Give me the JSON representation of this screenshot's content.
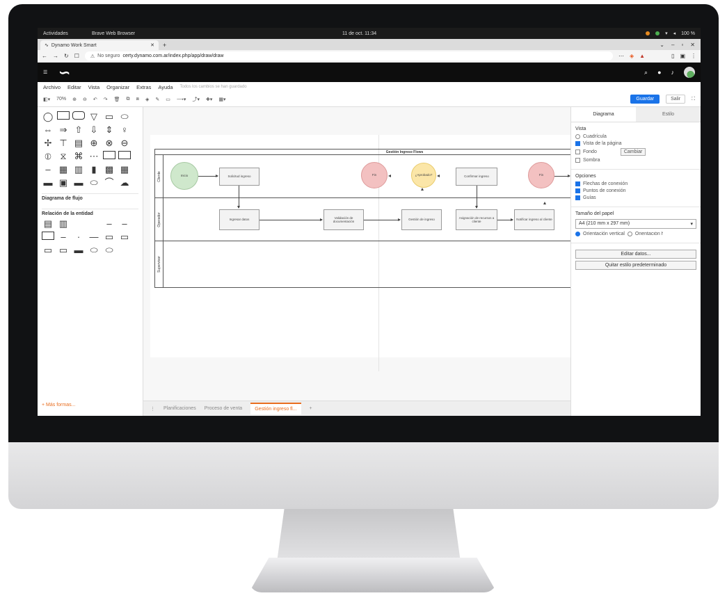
{
  "os": {
    "activities": "Actividades",
    "app_name": "Brave Web Browser",
    "clock": "11 de oct. 11:34",
    "battery": "100 %"
  },
  "browser": {
    "tab_title": "Dynamo Work Smart",
    "url_prefix": "No seguro",
    "url": "certy.dynamo.com.ar/index.php/app/draw/draw"
  },
  "menu": [
    "Archivo",
    "Editar",
    "Vista",
    "Organizar",
    "Extras",
    "Ayuda"
  ],
  "menu_note": "Todos los cambios se han guardado",
  "toolbar": {
    "zoom": "70%",
    "save_label": "Guardar",
    "exit_label": "Salir"
  },
  "sidebar": {
    "section_flow": "Diagrama de flujo",
    "section_entity": "Relación de la entidad",
    "more_shapes": "+ Más formas..."
  },
  "diagram": {
    "pool_title": "Gestión Ingreso Flows",
    "lanes": [
      "Cliente",
      "Operador",
      "Supervisor"
    ],
    "nodes": {
      "start": "Inicio",
      "request": "Solicitud ingreso",
      "end1": "Fin",
      "decision": "¿Aprobado?",
      "confirm": "Confirmar ingreso",
      "end2": "Fin",
      "register": "Ingresar datos",
      "validate": "Validación de documentación",
      "manage": "Gestión de ingreso",
      "assign": "Asignación de recursos a cliente",
      "notify": "Notificar ingreso al cliente"
    }
  },
  "page_tabs": [
    "Planificaciones",
    "Proceso de venta",
    "Gestión ingreso fl..."
  ],
  "format_panel": {
    "tab_diagram": "Diagrama",
    "tab_style": "Estilo",
    "view_title": "Vista",
    "view_options": [
      {
        "label": "Cuadrícula",
        "checked": false
      },
      {
        "label": "Vista de la página",
        "checked": true
      },
      {
        "label": "Fondo",
        "checked": false
      },
      {
        "label": "Sombra",
        "checked": false
      }
    ],
    "change_label": "Cambiar",
    "options_title": "Opciones",
    "options": [
      {
        "label": "Flechas de conexión",
        "checked": true
      },
      {
        "label": "Puntos de conexión",
        "checked": true
      },
      {
        "label": "Guías",
        "checked": true
      }
    ],
    "paper_title": "Tamaño del papel",
    "paper_size": "A4 (210 mm x 297 mm)",
    "orientation_vertical": "Orientación vertical",
    "orientation_horizontal": "Orientación horizontal",
    "edit_data": "Editar datos...",
    "clear_style": "Quitar estilo predeterminado"
  }
}
